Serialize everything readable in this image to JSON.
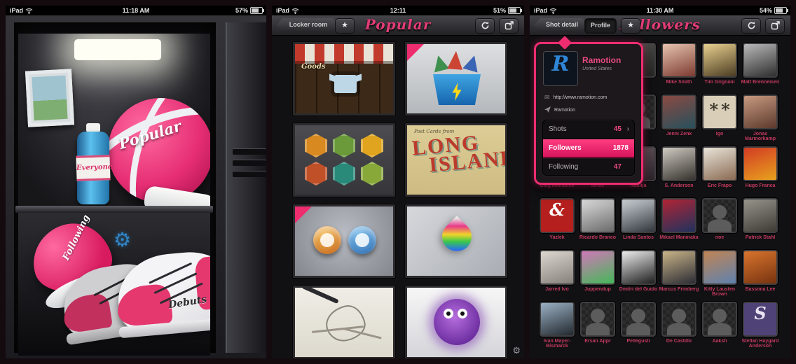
{
  "app": {
    "accent": "#ed2d6f"
  },
  "locker_panel": {
    "status": {
      "carrier": "iPad",
      "time": "11:18 AM",
      "battery": "57%"
    },
    "items": {
      "basketball_label": "Popular",
      "bottle_label": "Everyone",
      "cap_label": "Following",
      "sneakers_label": "Debuts"
    }
  },
  "popular_panel": {
    "status": {
      "carrier": "iPad",
      "time": "12:11",
      "battery": "51%"
    },
    "header": {
      "back_label": "Locker room",
      "title": "Popular"
    },
    "shots": [
      {
        "desc": "Goods storefront with striped awning and t-shirt",
        "sign": "Goods"
      },
      {
        "desc": "Blue basket with paper boats and lightning bolt",
        "ribbon": true
      },
      {
        "desc": "Set of six hexagonal badge icons"
      },
      {
        "desc": "Vintage Long Island postcard",
        "small_text": "Post Cards from",
        "big_text": "LONG",
        "big_text2": "ISLAND"
      },
      {
        "desc": "Two glossy round app icons",
        "ribbon": true
      },
      {
        "desc": "Rainbow colored water drop"
      },
      {
        "desc": "Pencil sketch illustration"
      },
      {
        "desc": "Purple furry monster character"
      }
    ]
  },
  "followers_panel": {
    "status": {
      "carrier": "iPad",
      "time": "11:30 AM",
      "battery": "54%"
    },
    "header": {
      "back_label": "Shot detail",
      "profile_label": "Profile",
      "title": "Followers"
    },
    "popover": {
      "name": "Ramotion",
      "subtitle": "United States",
      "website": "http://www.ramotion.com",
      "team": "Ramotion",
      "stats": [
        {
          "label": "Shots",
          "value": "45"
        },
        {
          "label": "Followers",
          "value": "1878"
        },
        {
          "label": "Following",
          "value": "47"
        }
      ]
    },
    "followers": [
      {
        "name": "",
        "kind": "photo",
        "c1": "#3a3a3e",
        "c2": "#1c1c20"
      },
      {
        "name": "",
        "kind": "photo",
        "c1": "#4a3a34",
        "c2": "#241c18"
      },
      {
        "name": "",
        "kind": "photo",
        "c1": "#50504e",
        "c2": "#262624"
      },
      {
        "name": "Mike Smith",
        "kind": "photo",
        "c1": "#e6c3ae",
        "c2": "#7c3a30"
      },
      {
        "name": "Tim Grignani",
        "kind": "photo",
        "c1": "#e9d08e",
        "c2": "#4a3c22"
      },
      {
        "name": "Matt Brenneisen",
        "kind": "photo",
        "c1": "#b9b9b9",
        "c2": "#2e2e2e"
      },
      {
        "name": "",
        "kind": "photo",
        "c1": "#3c3440",
        "c2": "#1a161e"
      },
      {
        "name": "",
        "kind": "photo",
        "c1": "#343c44",
        "c2": "#161a20"
      },
      {
        "name": "",
        "kind": "placeholder"
      },
      {
        "name": "Jenni Zenk",
        "kind": "photo",
        "c1": "#8a4a42",
        "c2": "#27505c"
      },
      {
        "name": "Igo",
        "kind": "logo",
        "c1": "#d9cfb8",
        "glyph": "∗∗",
        "gc": "#3a342a"
      },
      {
        "name": "Jonas Marmorkamp",
        "kind": "photo",
        "c1": "#c79a80",
        "c2": "#5c392c"
      },
      {
        "name": "Oleg Mikhailov",
        "kind": "photo",
        "c1": "#44424a",
        "c2": "#202026"
      },
      {
        "name": "Ionas",
        "kind": "photo",
        "c1": "#5a4a40",
        "c2": "#2a221c"
      },
      {
        "name": "Natilija",
        "kind": "photo",
        "c1": "#6a5a62",
        "c2": "#2c242a"
      },
      {
        "name": "S. Anderson",
        "kind": "photo",
        "c1": "#cfcbc2",
        "c2": "#35312c"
      },
      {
        "name": "Eric Frapo",
        "kind": "photo",
        "c1": "#e9e5da",
        "c2": "#8a6a52"
      },
      {
        "name": "Hugo Franca",
        "kind": "photo",
        "c1": "#d23b24",
        "c2": "#e8a21e"
      },
      {
        "name": "Yazlek",
        "kind": "logo",
        "c1": "#b5201e",
        "glyph": "&",
        "gc": "#ffffff"
      },
      {
        "name": "Ricardo Branco",
        "kind": "photo",
        "c1": "#dcdcdc",
        "c2": "#6a6a6a"
      },
      {
        "name": "Linda Santos",
        "kind": "photo",
        "c1": "#ccd2d6",
        "c2": "#30363c"
      },
      {
        "name": "Mikael Maninaka",
        "kind": "photo",
        "c1": "#b02434",
        "c2": "#20325e"
      },
      {
        "name": "noe",
        "kind": "placeholder"
      },
      {
        "name": "Patrick Stahl",
        "kind": "photo",
        "c1": "#96948a",
        "c2": "#3c3a34"
      },
      {
        "name": "Jarred Ivo",
        "kind": "photo",
        "c1": "#dcd8d0",
        "c2": "#86807a"
      },
      {
        "name": "Juppendup",
        "kind": "photo",
        "c1": "#d078b8",
        "c2": "#44b858"
      },
      {
        "name": "Dmitri del Guido",
        "kind": "photo",
        "c1": "#ececec",
        "c2": "#1e1e1e"
      },
      {
        "name": "Marcus Frimberg",
        "kind": "photo",
        "c1": "#c9b488",
        "c2": "#2c2c34"
      },
      {
        "name": "Kitty Lausten Brown",
        "kind": "photo",
        "c1": "#c08455",
        "c2": "#5e82ae"
      },
      {
        "name": "Bassima Lee",
        "kind": "photo",
        "c1": "#d8742e",
        "c2": "#77330f"
      },
      {
        "name": "Ivan Mayer-Bismarck",
        "kind": "photo",
        "c1": "#9ab0c4",
        "c2": "#22282e"
      },
      {
        "name": "Ersan Appr",
        "kind": "placeholder"
      },
      {
        "name": "Pellegusti",
        "kind": "placeholder"
      },
      {
        "name": "De Castillo",
        "kind": "placeholder"
      },
      {
        "name": "Aaksh",
        "kind": "placeholder"
      },
      {
        "name": "Stellan Haygard Anderson",
        "kind": "logo",
        "c1": "#4e4276",
        "glyph": "S",
        "gc": "#e8e4f2"
      }
    ]
  }
}
